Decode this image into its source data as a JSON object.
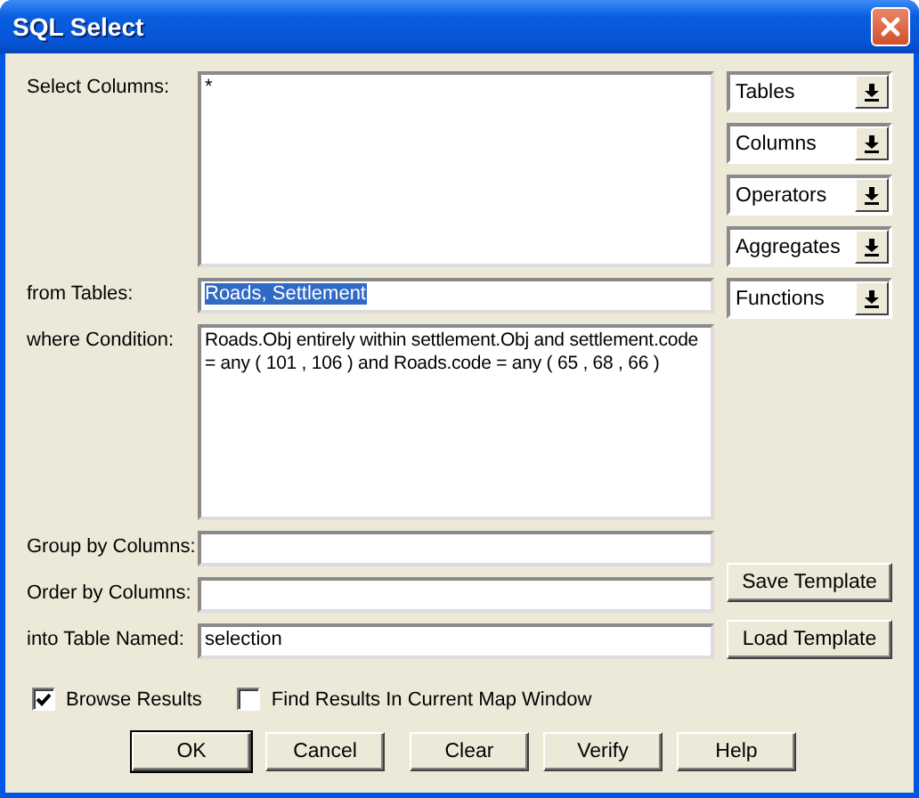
{
  "window": {
    "title": "SQL Select"
  },
  "fields": [
    {
      "label": "Select Columns:",
      "kind": "multiline",
      "value": "*",
      "text_selected": false
    },
    {
      "label": "from Tables:",
      "kind": "line",
      "value": "Roads, Settlement",
      "text_selected": true
    },
    {
      "label": "where Condition:",
      "kind": "multiline",
      "value": "Roads.Obj entirely within settlement.Obj and settlement.code = any ( 101 , 106 ) and Roads.code = any ( 65 , 68 , 66 )",
      "text_selected": false
    },
    {
      "label": "Group by Columns:",
      "kind": "line"
    },
    {
      "label": "Order by Columns:",
      "kind": "line"
    },
    {
      "label": "into Table Named:",
      "kind": "line",
      "value": "selection",
      "text_selected": false
    }
  ],
  "dropdowns": [
    "Tables",
    "Columns",
    "Operators",
    "Aggregates",
    "Functions"
  ],
  "template_buttons": [
    "Save Template",
    "Load Template"
  ],
  "checkboxes": [
    {
      "label": "Browse Results",
      "checked": true
    },
    {
      "label": "Find Results In Current Map Window",
      "checked": false
    }
  ],
  "buttons": [
    {
      "label": "OK",
      "default": true
    },
    {
      "label": "Cancel",
      "default": false
    },
    {
      "label": "Clear",
      "default": false
    },
    {
      "label": "Verify",
      "default": false
    },
    {
      "label": "Help",
      "default": false
    }
  ]
}
